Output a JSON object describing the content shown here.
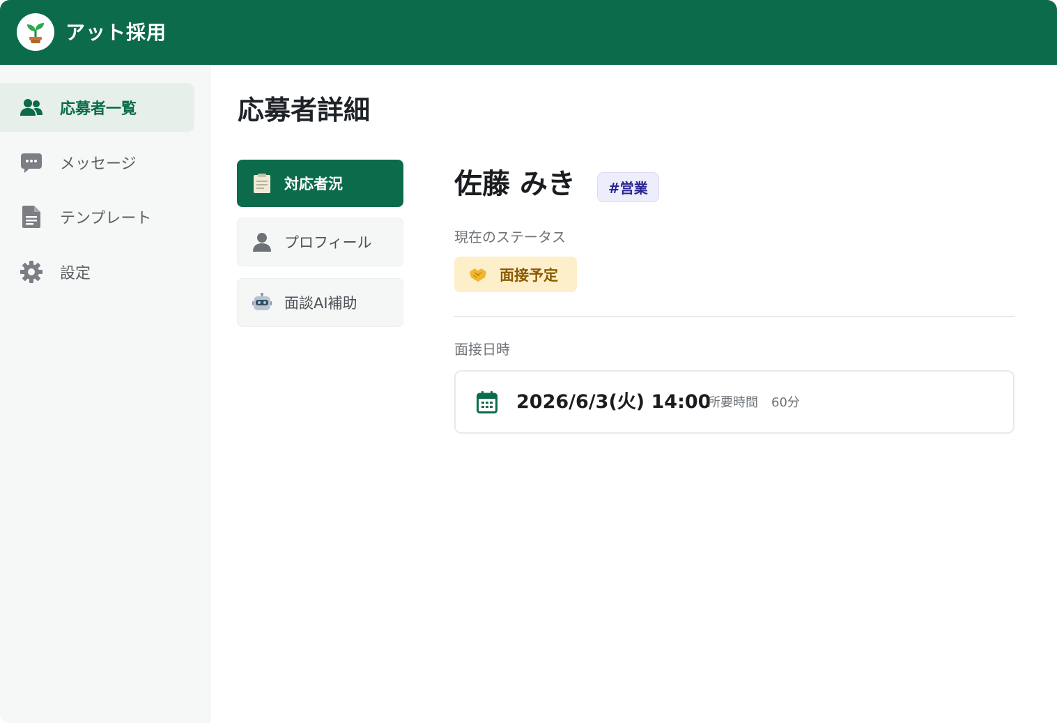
{
  "app": {
    "title": "アット採用",
    "logo_icon": "sprout-icon",
    "brand_color": "#0b6b4a"
  },
  "sidebar": {
    "items": [
      {
        "label": "応募者一覧",
        "icon": "users-icon",
        "active": true
      },
      {
        "label": "メッセージ",
        "icon": "chat-icon",
        "active": false
      },
      {
        "label": "テンプレート",
        "icon": "document-icon",
        "active": false
      },
      {
        "label": "設定",
        "icon": "gear-icon",
        "active": false
      }
    ]
  },
  "main": {
    "page_title": "応募者詳細",
    "tabs": [
      {
        "label": "対応者況",
        "icon": "clipboard-icon",
        "active": true
      },
      {
        "label": "プロフィール",
        "icon": "person-icon",
        "active": false
      },
      {
        "label": "面談AI補助",
        "icon": "robot-icon",
        "active": false
      }
    ],
    "applicant": {
      "name": "佐藤 みき",
      "department_tag": "#営業"
    },
    "status": {
      "label": "現在のステータス",
      "value": "面接予定",
      "icon": "handshake-icon",
      "color": "#fdefc9"
    },
    "interview": {
      "label": "面接日時",
      "datetime": "2026/6/3(火) 14:00",
      "duration_label": "所要時間",
      "duration_value": "60分",
      "icon": "calendar-icon"
    }
  }
}
